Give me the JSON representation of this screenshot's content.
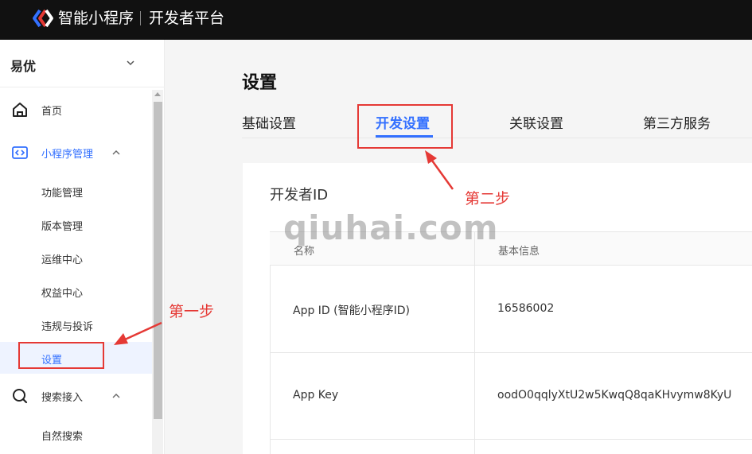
{
  "topbar": {
    "brand": "智能小程序",
    "platform": "开发者平台"
  },
  "account": {
    "name": "易优"
  },
  "sidebar": {
    "home": "首页",
    "mini_program_mgmt": "小程序管理",
    "sub_items": [
      "功能管理",
      "版本管理",
      "运维中心",
      "权益中心",
      "违规与投诉",
      "设置"
    ],
    "search_access": "搜索接入",
    "natural_search": "自然搜索"
  },
  "page": {
    "title": "设置"
  },
  "tabs": [
    "基础设置",
    "开发设置",
    "关联设置",
    "第三方服务"
  ],
  "card": {
    "title": "开发者ID",
    "headers": [
      "名称",
      "基本信息"
    ],
    "rows": [
      {
        "name": "App ID (智能小程序ID)",
        "value": "16586002"
      },
      {
        "name": "App Key",
        "value": "oodO0qqlyXtU2w5KwqQ8qaKHvymw8KyU"
      }
    ]
  },
  "watermark": "qiuhai.com",
  "annotations": {
    "step1": "第一步",
    "step2": "第二步"
  },
  "colors": {
    "accent": "#3370ff",
    "annotation": "#e53935",
    "topbar": "#111111"
  }
}
